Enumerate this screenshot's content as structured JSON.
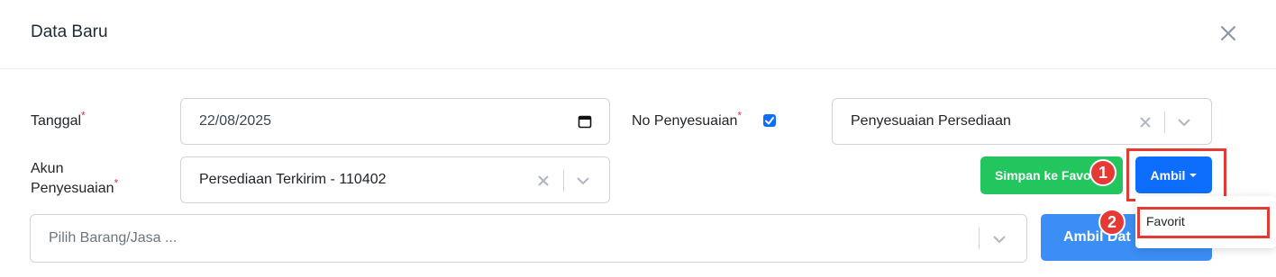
{
  "modal": {
    "title": "Data Baru"
  },
  "form": {
    "tanggal": {
      "label": "Tanggal",
      "required_mark": "*",
      "value": "22/08/2025"
    },
    "no_penyesuaian": {
      "label": "No Penyesuaian",
      "required_mark": "*",
      "checked": true,
      "value": "Penyesuaian Persediaan"
    },
    "akun": {
      "label_line1": "Akun",
      "label_line2": "Penyesuaian",
      "required_mark": "*",
      "value": "Persediaan Terkirim - 110402"
    },
    "barang": {
      "placeholder": "Pilih Barang/Jasa ..."
    }
  },
  "buttons": {
    "simpan_favorit": "Simpan ke Favo",
    "ambil": "Ambil",
    "ambil_data": "Ambil Dat"
  },
  "dropdown": {
    "items": [
      "Favorit"
    ]
  },
  "annotations": {
    "step1": "1",
    "step2": "2"
  },
  "colors": {
    "primary": "#0d6efd",
    "success": "#22c55e",
    "annotation": "#e53935",
    "required": "#dc3545"
  }
}
